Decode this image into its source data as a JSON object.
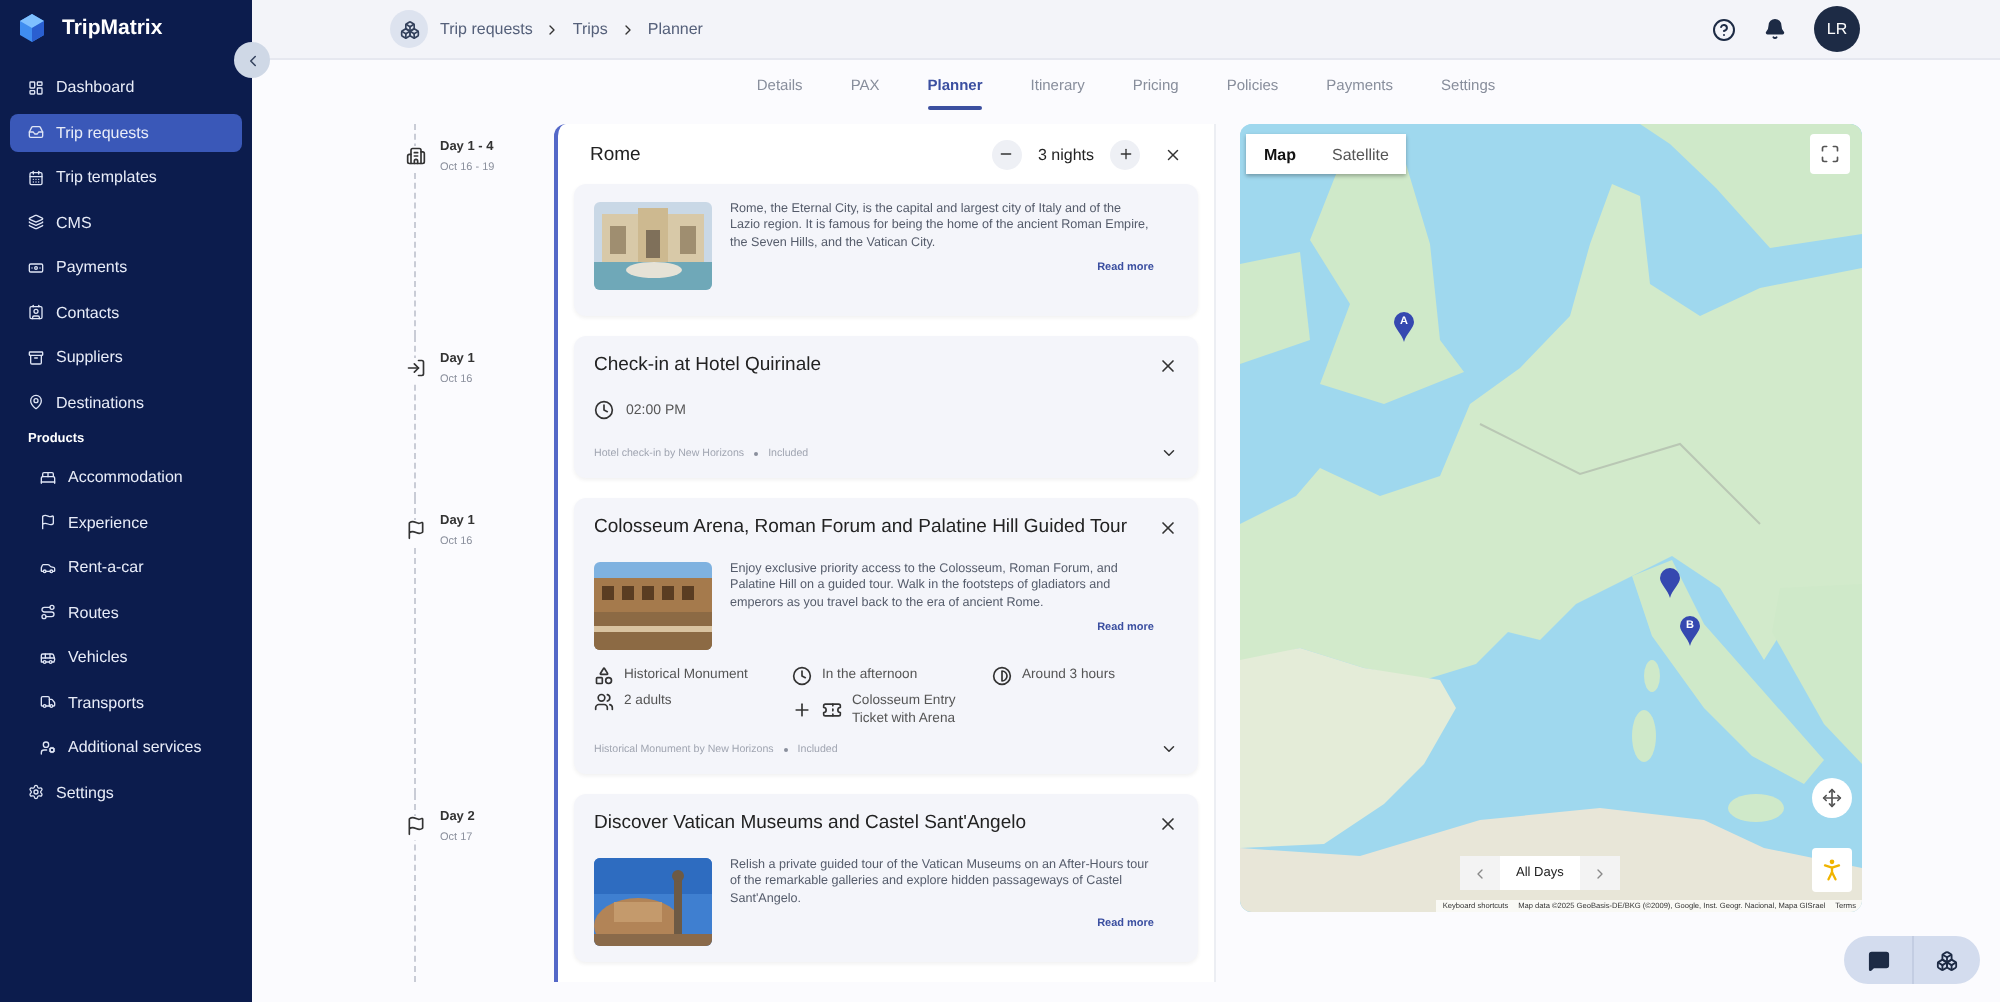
{
  "app": {
    "name": "TripMatrix"
  },
  "sidebar": {
    "items": [
      {
        "kind": "link",
        "label": "Dashboard",
        "selected": false
      },
      {
        "kind": "link",
        "label": "Trip requests",
        "selected": true
      },
      {
        "kind": "link",
        "label": "Trip templates",
        "selected": false
      },
      {
        "kind": "link",
        "label": "CMS",
        "selected": false
      },
      {
        "kind": "link",
        "label": "Payments",
        "selected": false
      },
      {
        "kind": "link",
        "label": "Contacts",
        "selected": false
      },
      {
        "kind": "link",
        "label": "Suppliers",
        "selected": false
      },
      {
        "kind": "link",
        "label": "Destinations",
        "selected": false
      },
      {
        "kind": "section",
        "label": "Products",
        "children": [
          {
            "label": "Accommodation",
            "selected": false
          },
          {
            "label": "Experience",
            "selected": false
          },
          {
            "label": "Rent-a-car",
            "selected": false
          },
          {
            "label": "Routes",
            "selected": false
          },
          {
            "label": "Vehicles",
            "selected": false
          },
          {
            "label": "Transports",
            "selected": false
          },
          {
            "label": "Additional services",
            "selected": false
          }
        ]
      },
      {
        "kind": "link",
        "label": "Settings",
        "selected": false
      }
    ]
  },
  "breadcrumb": [
    "Trip requests",
    "Trips",
    "Planner"
  ],
  "user": {
    "initials": "LR"
  },
  "tabs": [
    {
      "label": "Details",
      "selected": false
    },
    {
      "label": "PAX",
      "selected": false
    },
    {
      "label": "Planner",
      "selected": true
    },
    {
      "label": "Itinerary",
      "selected": false
    },
    {
      "label": "Pricing",
      "selected": false
    },
    {
      "label": "Policies",
      "selected": false
    },
    {
      "label": "Payments",
      "selected": false
    },
    {
      "label": "Settings",
      "selected": false
    }
  ],
  "planner": {
    "entries": [
      {
        "kind": "stay",
        "day": "Day 1 - 4",
        "date": "Oct 16 - 19",
        "title": "Rome",
        "nights": "3 nights",
        "description": "Rome, the Eternal City, is the capital and largest city of Italy and of the Lazio region. It is famous for being the home of the ancient Roman Empire, the Seven Hills, and the Vatican City.",
        "read_more": "Read more"
      },
      {
        "kind": "checkin",
        "day": "Day 1",
        "date": "Oct 16",
        "title": "Check-in at Hotel Quirinale",
        "time": "02:00 PM",
        "provider": "Hotel check-in by New Horizons",
        "status": "Included",
        "expanded": false
      },
      {
        "kind": "activity",
        "day": "Day 1",
        "date": "Oct 16",
        "title": "Colosseum Arena, Roman Forum and Palatine Hill Guided Tour",
        "description": "Enjoy exclusive priority access to the Colosseum, Roman Forum, and Palatine Hill on a guided tour. Walk in the footsteps of gladiators and emperors as you travel back to the era of ancient Rome.",
        "read_more": "Read more",
        "details": {
          "category": "Historical Monument",
          "time_of_day": "In the afternoon",
          "duration": "Around 3 hours",
          "pax": "2 adults",
          "extra": "Colosseum Entry Ticket with Arena"
        },
        "provider": "Historical Monument by New Horizons",
        "status": "Included",
        "expanded": false
      },
      {
        "kind": "activity",
        "day": "Day 2",
        "date": "Oct 17",
        "title": "Discover Vatican Museums and Castel Sant'Angelo",
        "description": "Relish a private guided tour of the Vatican Museums on an After-Hours tour of the remarkable galleries and explore hidden passageways of Castel Sant'Angelo.",
        "read_more": "Read more"
      }
    ]
  },
  "map": {
    "map_types": [
      {
        "label": "Map",
        "selected": true
      },
      {
        "label": "Satellite",
        "selected": false
      }
    ],
    "markers": [
      {
        "label": "A"
      },
      {
        "label": "B"
      }
    ],
    "day_filter": "All Days",
    "attribution": {
      "shortcuts": "Keyboard shortcuts",
      "data": "Map data ©2025 GeoBasis-DE/BKG (©2009), Google, Inst. Geogr. Nacional, Mapa GISrael",
      "terms": "Terms"
    }
  }
}
